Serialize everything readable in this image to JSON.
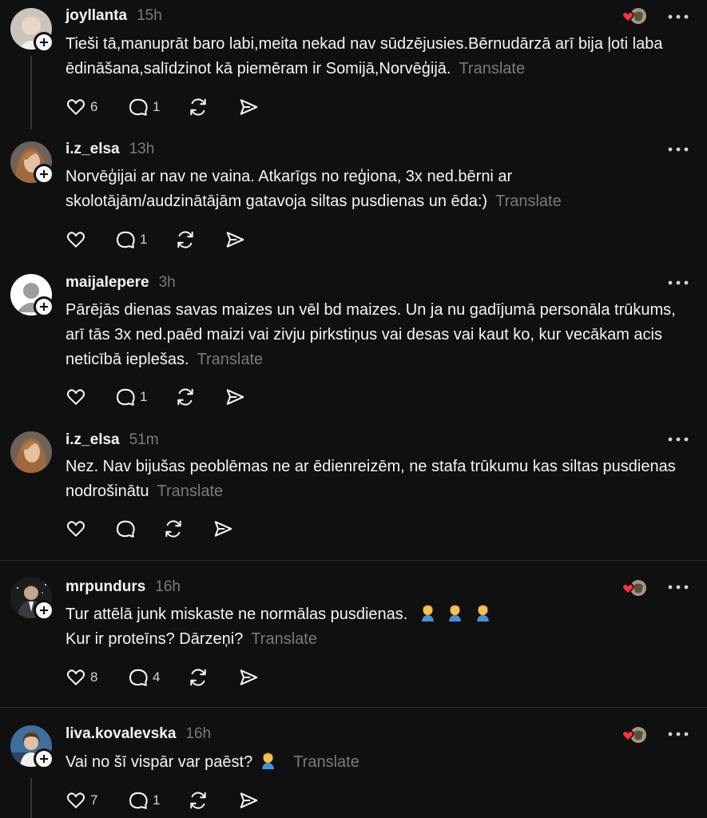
{
  "translate_label": "Translate",
  "posts": [
    {
      "username": "joyllanta",
      "time": "15h",
      "text": "Tieši tā,manuprāt baro labi,meita nekad nav sūdzējusies.Bērnudārzā arī bija ļoti laba ēdināšana,salīdzinot kā piemēram ir Somijā,Norvēģijā.",
      "likes": "6",
      "replies": "1",
      "reposts": "",
      "has_reaction": true
    },
    {
      "username": "i.z_elsa",
      "time": "13h",
      "text": "Norvēģijai ar nav ne vaina. Atkarīgs no reģiona, 3x ned.bērni ar skolotājām/audzinātājām gatavoja siltas pusdienas un ēda:)",
      "likes": "",
      "replies": "1",
      "reposts": "",
      "has_reaction": false
    },
    {
      "username": "maijalepere",
      "time": "3h",
      "text": "Pārējās dienas savas maizes un vēl bd maizes. Un ja nu gadījumā personāla trūkums, arī tās 3x ned.paēd maizi vai zivju pirkstiņus vai desas vai kaut ko, kur vecākam acis neticībā ieplešas.",
      "likes": "",
      "replies": "1",
      "reposts": "",
      "has_reaction": false
    },
    {
      "username": "i.z_elsa",
      "time": "51m",
      "text": "Nez. Nav bijušas peoblēmas ne ar ēdienreizēm, ne stafa trūkumu kas siltas pusdienas nodrošinātu",
      "likes": "",
      "replies": "",
      "reposts": "",
      "has_reaction": false
    },
    {
      "username": "mrpundurs",
      "time": "16h",
      "text_line1": "Tur attēlā junk miskaste ne normālas pusdienas.",
      "text_line2": "Kur ir proteīns? Dārzeņi?",
      "likes": "8",
      "replies": "4",
      "reposts": "",
      "has_reaction": true
    },
    {
      "username": "liva.kovalevska",
      "time": "16h",
      "text": "Vai no šī vispār var paēst?",
      "likes": "7",
      "replies": "1",
      "reposts": "",
      "has_reaction": true
    }
  ],
  "icons": [
    "heart-icon",
    "comment-icon",
    "repost-icon",
    "share-icon",
    "more-icon",
    "plus-icon",
    "facepalm-emoji"
  ],
  "colors": {
    "background": "#101010",
    "text": "#f3f5f7",
    "muted": "#777b80",
    "reaction_heart": "#ff3040"
  }
}
